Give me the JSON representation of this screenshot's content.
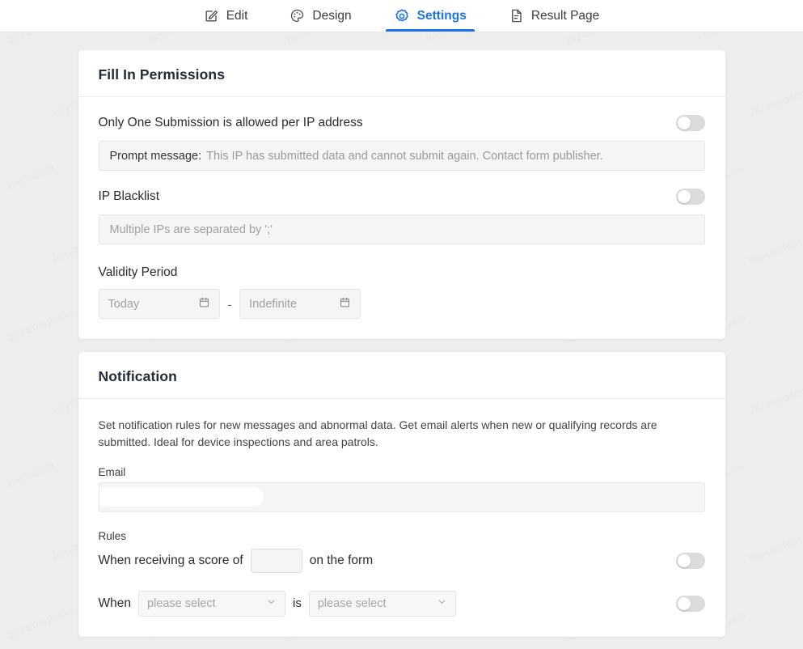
{
  "tabs": [
    {
      "label": "Edit",
      "icon": "edit-pencil-icon",
      "active": false
    },
    {
      "label": "Design",
      "icon": "palette-icon",
      "active": false
    },
    {
      "label": "Settings",
      "icon": "gear-icon",
      "active": true
    },
    {
      "label": "Result Page",
      "icon": "document-icon",
      "active": false
    }
  ],
  "colors": {
    "accent": "#1a73e8",
    "page_bg": "#ededed",
    "card_bg": "#ffffff"
  },
  "permissions": {
    "title": "Fill In Permissions",
    "one_submission_label": "Only One Submission is allowed per IP address",
    "prompt_key": "Prompt message:",
    "prompt_value": "This IP has submitted data and cannot submit again. Contact form publisher.",
    "blacklist_label": "IP Blacklist",
    "blacklist_placeholder": "Multiple IPs are separated by ';'",
    "validity_label": "Validity Period",
    "date_start_placeholder": "Today",
    "date_end_placeholder": "Indefinite",
    "date_separator": "-"
  },
  "notification": {
    "title": "Notification",
    "description": "Set notification rules for new messages and abnormal data. Get email alerts when new or qualifying records are submitted. Ideal for device inspections and area patrols.",
    "email_label": "Email",
    "email_value": "",
    "rules_label": "Rules",
    "rule_score_prefix": "When receiving a score of",
    "rule_score_value": "",
    "rule_score_suffix": "on the form",
    "rule_when_prefix": "When",
    "rule_when_field": "please select",
    "rule_when_is": "is",
    "rule_when_value": "please select"
  },
  "watermarks": [
    "2024/08-jinxin",
    "imyfone-2024",
    "jinxin-2024/08",
    "imyfone-hm",
    "2024/08-imyfone",
    "hm-jinxin",
    "imyfone2024",
    "08-jinxin",
    "2024/08",
    "imyfone",
    "jinxin-hm",
    "2024-imyfone",
    "jinxin2024",
    "08-imyfone",
    "hm-2024/08",
    "imyfone-jx",
    "2024/08-hm",
    "jinxin-im",
    "imy-2024",
    "jx-2024/08",
    "2024/08-jx",
    "imyfone-08",
    "jinxin-2024",
    "hm-imyfone"
  ]
}
